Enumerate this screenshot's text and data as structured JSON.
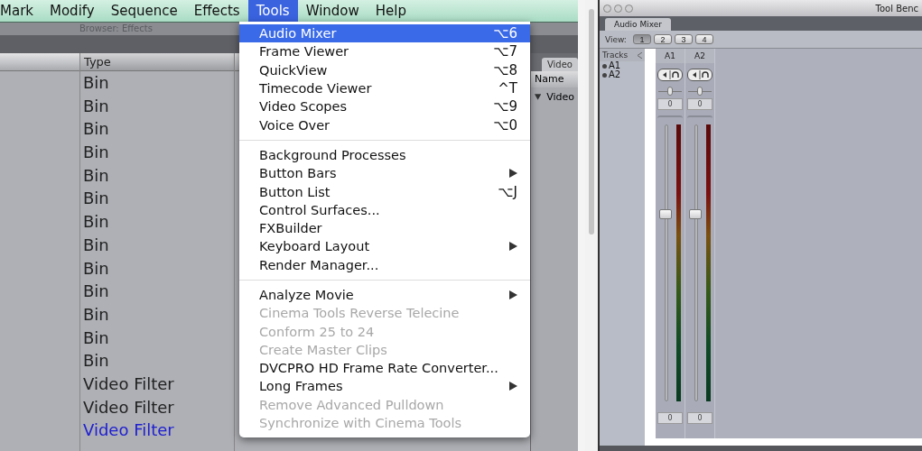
{
  "menubar": {
    "items": [
      {
        "label": "Mark",
        "selected": false
      },
      {
        "label": "Modify",
        "selected": false
      },
      {
        "label": "Sequence",
        "selected": false
      },
      {
        "label": "Effects",
        "selected": false
      },
      {
        "label": "Tools",
        "selected": true
      },
      {
        "label": "Window",
        "selected": false
      },
      {
        "label": "Help",
        "selected": false
      }
    ]
  },
  "browser": {
    "title": "Browser: Effects",
    "column": "Type",
    "rows": [
      {
        "type": "Bin",
        "selected": false
      },
      {
        "type": "Bin",
        "selected": false
      },
      {
        "type": "Bin",
        "selected": false
      },
      {
        "type": "Bin",
        "selected": false
      },
      {
        "type": "Bin",
        "selected": false
      },
      {
        "type": "Bin",
        "selected": false
      },
      {
        "type": "Bin",
        "selected": false
      },
      {
        "type": "Bin",
        "selected": false
      },
      {
        "type": "Bin",
        "selected": false
      },
      {
        "type": "Bin",
        "selected": false
      },
      {
        "type": "Bin",
        "selected": false
      },
      {
        "type": "Bin",
        "selected": false
      },
      {
        "type": "Bin",
        "selected": false
      },
      {
        "type": "Video Filter",
        "selected": false
      },
      {
        "type": "Video Filter",
        "selected": false
      },
      {
        "type": "Video Filter",
        "selected": true
      }
    ]
  },
  "side_window": {
    "tab": "Video",
    "column": "Name",
    "rows": [
      {
        "name": "Video",
        "expanded": true
      }
    ]
  },
  "menu": {
    "groups": [
      [
        {
          "label": "Audio Mixer",
          "shortcut": "⌥6",
          "submenu": false,
          "disabled": false,
          "selected": true
        },
        {
          "label": "Frame Viewer",
          "shortcut": "⌥7",
          "submenu": false,
          "disabled": false,
          "selected": false
        },
        {
          "label": "QuickView",
          "shortcut": "⌥8",
          "submenu": false,
          "disabled": false,
          "selected": false
        },
        {
          "label": "Timecode Viewer",
          "shortcut": "^T",
          "submenu": false,
          "disabled": false,
          "selected": false
        },
        {
          "label": "Video Scopes",
          "shortcut": "⌥9",
          "submenu": false,
          "disabled": false,
          "selected": false
        },
        {
          "label": "Voice Over",
          "shortcut": "⌥0",
          "submenu": false,
          "disabled": false,
          "selected": false
        }
      ],
      [
        {
          "label": "Background Processes",
          "submenu": false,
          "disabled": false,
          "selected": false
        },
        {
          "label": "Button Bars",
          "submenu": true,
          "disabled": false,
          "selected": false
        },
        {
          "label": "Button List",
          "shortcut": "⌥J",
          "submenu": false,
          "disabled": false,
          "selected": false
        },
        {
          "label": "Control Surfaces...",
          "submenu": false,
          "disabled": false,
          "selected": false
        },
        {
          "label": "FXBuilder",
          "submenu": false,
          "disabled": false,
          "selected": false
        },
        {
          "label": "Keyboard Layout",
          "submenu": true,
          "disabled": false,
          "selected": false
        },
        {
          "label": "Render Manager...",
          "submenu": false,
          "disabled": false,
          "selected": false
        }
      ],
      [
        {
          "label": "Analyze Movie",
          "submenu": true,
          "disabled": false,
          "selected": false
        },
        {
          "label": "Cinema Tools Reverse Telecine",
          "submenu": false,
          "disabled": true,
          "selected": false
        },
        {
          "label": "Conform 25 to 24",
          "submenu": false,
          "disabled": true,
          "selected": false
        },
        {
          "label": "Create Master Clips",
          "submenu": false,
          "disabled": true,
          "selected": false
        },
        {
          "label": "DVCPRO HD Frame Rate Converter...",
          "submenu": false,
          "disabled": false,
          "selected": false
        },
        {
          "label": "Long Frames",
          "submenu": true,
          "disabled": false,
          "selected": false
        },
        {
          "label": "Remove Advanced Pulldown",
          "submenu": false,
          "disabled": true,
          "selected": false
        },
        {
          "label": "Synchronize with Cinema Tools",
          "submenu": false,
          "disabled": true,
          "selected": false
        }
      ]
    ]
  },
  "tool_bench": {
    "title": "Tool Benc",
    "tab": "Audio Mixer",
    "view_label": "View:",
    "view_buttons": [
      {
        "label": "1",
        "selected": true
      },
      {
        "label": "2",
        "selected": false
      },
      {
        "label": "3",
        "selected": false
      },
      {
        "label": "4",
        "selected": false
      }
    ],
    "tracks_header": "Tracks",
    "tracks": [
      {
        "name": "A1"
      },
      {
        "name": "A2"
      }
    ],
    "channels": [
      {
        "name": "A1",
        "pan": {
          "level": 0.5
        },
        "pan_reading": "0",
        "level": 0.69,
        "level_reading": "0"
      },
      {
        "name": "A2",
        "pan": {
          "level": 0.5
        },
        "pan_reading": "0",
        "level": 0.69,
        "level_reading": "0"
      }
    ]
  }
}
